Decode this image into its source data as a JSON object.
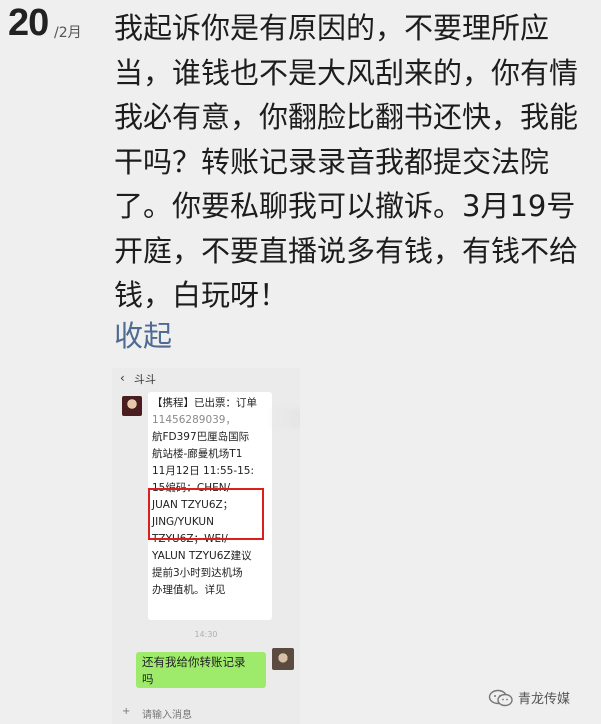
{
  "date": {
    "day": "20",
    "month": "/2月"
  },
  "post": {
    "lines": [
      "我起诉你是有原因的，不要理所应",
      "当，谁钱也不是大风刮来的，你有情",
      "我必有意，你翻脸比翻书还快，我能",
      "干吗？转账记录录音我都提交法院",
      "了。你要私聊我可以撤诉。3月19号",
      "开庭，不要直播说多有钱，有钱不给",
      "钱，白玩呀！"
    ],
    "collapse_label": "收起"
  },
  "chat_screenshot": {
    "back_glyph": "‹",
    "title": "斗斗",
    "incoming_message_lines": [
      "【携程】已出票：订单",
      "11456289039，",
      "航FD397巴厘岛国际",
      "航站楼-廊曼机场T1",
      "11月12日 11:55-15:",
      "15编码：CHEN/",
      "JUAN TZYU6Z；",
      "JING/YUKUN",
      "TZYU6Z；WEI/",
      "YALUN TZYU6Z建议",
      "提前3小时到达机场",
      "办理值机。详见"
    ],
    "time_divider": "14:30",
    "outgoing_message_lines": [
      "还有我给你转账记录",
      "吗"
    ],
    "input_bar": [
      "+",
      "请输入消息"
    ]
  },
  "watermark": {
    "name": "青龙传媒"
  },
  "colors": {
    "background": "#efefef",
    "link": "#4f6b92",
    "highlight_box": "#d9201c",
    "outgoing_bubble": "#9eea6a"
  }
}
